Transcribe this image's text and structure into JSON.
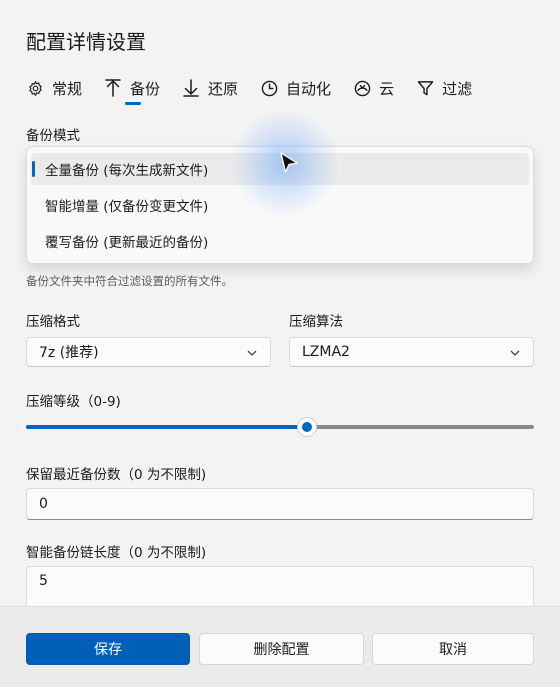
{
  "dialog": {
    "title": "配置详情设置"
  },
  "tabs": [
    {
      "label": "常规",
      "icon": "gear-icon"
    },
    {
      "label": "备份",
      "icon": "upload-arrow-icon",
      "active": true
    },
    {
      "label": "还原",
      "icon": "download-arrow-icon"
    },
    {
      "label": "自动化",
      "icon": "clock-icon"
    },
    {
      "label": "云",
      "icon": "cloud-icon"
    },
    {
      "label": "过滤",
      "icon": "filter-icon"
    }
  ],
  "backup_mode": {
    "label": "备份模式",
    "options": [
      "全量备份 (每次生成新文件)",
      "智能增量 (仅备份变更文件)",
      "覆写备份 (更新最近的备份)"
    ],
    "selected_index": 0,
    "description": "备份文件夹中符合过滤设置的所有文件。"
  },
  "compression_format": {
    "label": "压缩格式",
    "value": "7z (推荐)"
  },
  "compression_algorithm": {
    "label": "压缩算法",
    "value": "LZMA2"
  },
  "compression_level": {
    "label": "压缩等级（0-9)",
    "min": 0,
    "max": 9,
    "value": 5
  },
  "retain_count": {
    "label": "保留最近备份数（0 为不限制)",
    "value": "0"
  },
  "smart_chain": {
    "label": "智能备份链长度（0 为不限制)",
    "value": "5"
  },
  "footer": {
    "save": "保存",
    "delete": "删除配置",
    "cancel": "取消"
  },
  "colors": {
    "accent": "#0067c0",
    "primary_button": "#005fb8",
    "background": "#f3f3f3"
  }
}
